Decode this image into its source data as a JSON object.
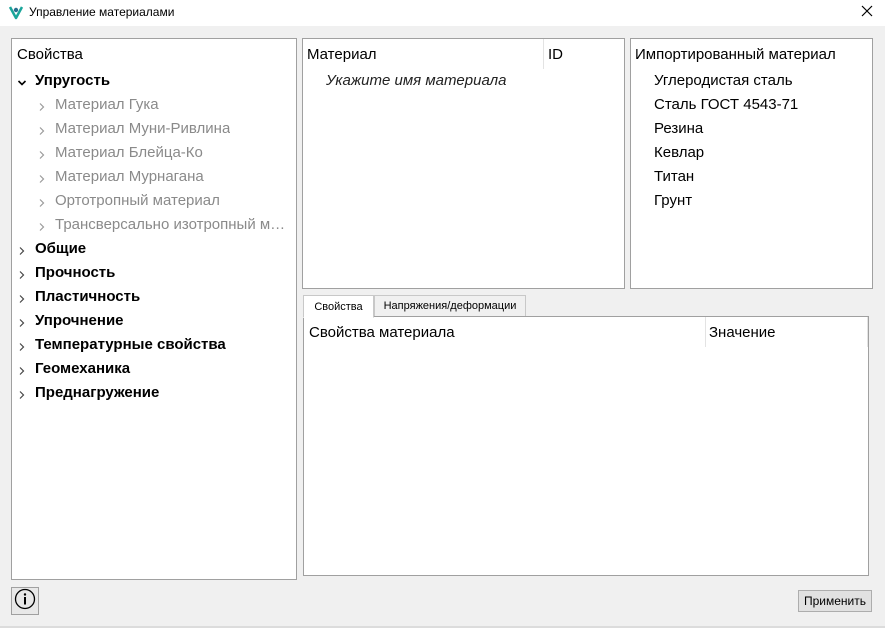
{
  "window": {
    "title": "Управление материалами",
    "app_icon": "app-logo-icon",
    "close_icon": "close-icon"
  },
  "properties_tree": {
    "header": "Свойства",
    "groups": [
      {
        "label": "Упругость",
        "expanded": true,
        "children": [
          "Материал Гука",
          "Материал Муни-Ривлина",
          "Материал Блейца-Ко",
          "Материал Мурнагана",
          "Ортотропный материал",
          "Трансверсально изотропный м…"
        ]
      },
      {
        "label": "Общие",
        "expanded": false
      },
      {
        "label": "Прочность",
        "expanded": false
      },
      {
        "label": "Пластичность",
        "expanded": false
      },
      {
        "label": "Упрочнение",
        "expanded": false
      },
      {
        "label": "Температурные свойства",
        "expanded": false
      },
      {
        "label": "Геомеханика",
        "expanded": false
      },
      {
        "label": "Преднагружение",
        "expanded": false
      }
    ]
  },
  "materials_table": {
    "columns": [
      "Материал",
      "ID"
    ],
    "placeholder": "Укажите имя материала"
  },
  "imported_materials": {
    "header": "Импортированный материал",
    "items": [
      "Углеродистая сталь",
      "Сталь ГОСТ 4543-71",
      "Резина",
      "Кевлар",
      "Титан",
      "Грунт"
    ]
  },
  "tabs": [
    {
      "label": "Свойства",
      "active": true
    },
    {
      "label": "Напряжения/деформации",
      "active": false
    }
  ],
  "properties_table": {
    "columns": [
      "Свойства материала",
      "Значение"
    ]
  },
  "footer": {
    "info_icon": "info-icon",
    "apply_label": "Применить"
  },
  "colors": {
    "child_text": "#8a8a8a",
    "border": "#a0a0a0",
    "background": "#f0f0f0",
    "logo_teal": "#1aa59a"
  }
}
